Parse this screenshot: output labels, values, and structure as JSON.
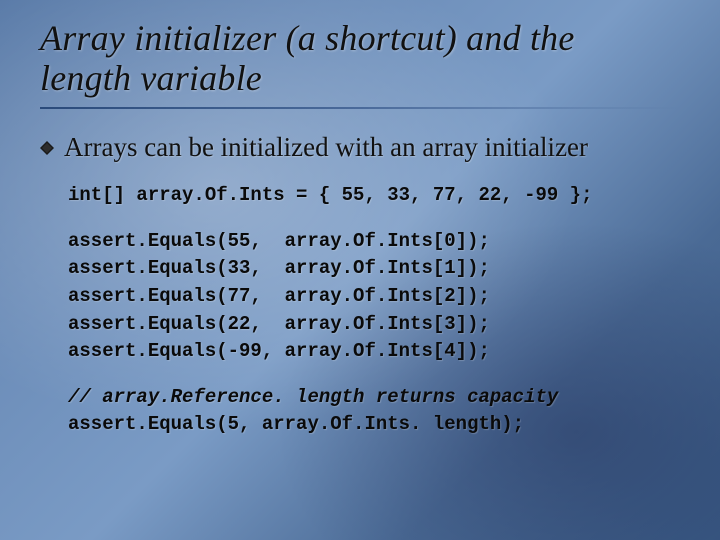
{
  "title_line1": "Array initializer (a shortcut) and the",
  "title_line2": "length variable",
  "bullet_text": "Arrays can be initialized with an array initializer",
  "code": {
    "decl": "int[] array.Of.Ints = { 55, 33, 77, 22, -99 };",
    "a0": "assert.Equals(55,  array.Of.Ints[0]);",
    "a1": "assert.Equals(33,  array.Of.Ints[1]);",
    "a2": "assert.Equals(77,  array.Of.Ints[2]);",
    "a3": "assert.Equals(22,  array.Of.Ints[3]);",
    "a4": "assert.Equals(-99, array.Of.Ints[4]);",
    "comment": "// array.Reference. length returns capacity",
    "len": "assert.Equals(5, array.Of.Ints. length);"
  }
}
